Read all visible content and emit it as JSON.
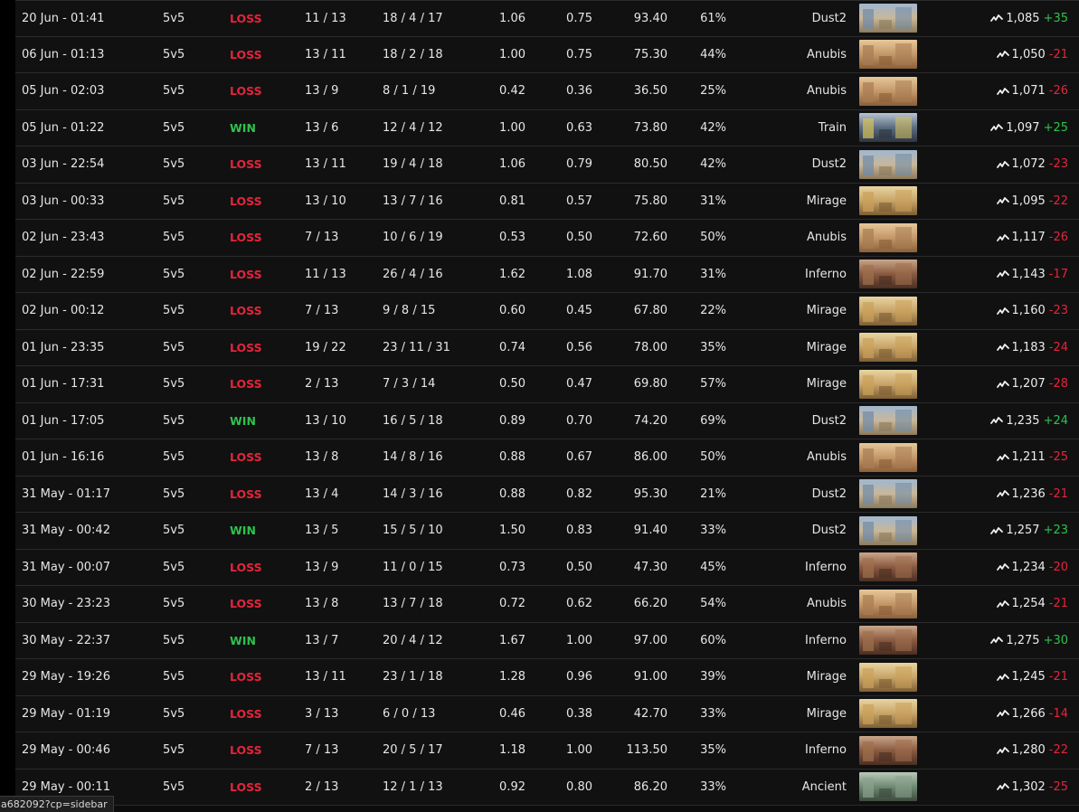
{
  "matches": [
    {
      "date": "20 Jun - 01:41",
      "mode": "5v5",
      "result": "LOSS",
      "score": "11 / 13",
      "kda": "18 / 4 / 17",
      "kd": "1.06",
      "kr": "0.75",
      "adr": "93.40",
      "hs": "61%",
      "map": "Dust2",
      "map_icon": "dust2-thumbnail",
      "elo": "1,085",
      "delta": "+35"
    },
    {
      "date": "06 Jun - 01:13",
      "mode": "5v5",
      "result": "LOSS",
      "score": "13 / 11",
      "kda": "18 / 2 / 18",
      "kd": "1.00",
      "kr": "0.75",
      "adr": "75.30",
      "hs": "44%",
      "map": "Anubis",
      "map_icon": "anubis-thumbnail",
      "elo": "1,050",
      "delta": "-21"
    },
    {
      "date": "05 Jun - 02:03",
      "mode": "5v5",
      "result": "LOSS",
      "score": "13 / 9",
      "kda": "8 / 1 / 19",
      "kd": "0.42",
      "kr": "0.36",
      "adr": "36.50",
      "hs": "25%",
      "map": "Anubis",
      "map_icon": "anubis-thumbnail",
      "elo": "1,071",
      "delta": "-26"
    },
    {
      "date": "05 Jun - 01:22",
      "mode": "5v5",
      "result": "WIN",
      "score": "13 / 6",
      "kda": "12 / 4 / 12",
      "kd": "1.00",
      "kr": "0.63",
      "adr": "73.80",
      "hs": "42%",
      "map": "Train",
      "map_icon": "train-thumbnail",
      "elo": "1,097",
      "delta": "+25"
    },
    {
      "date": "03 Jun - 22:54",
      "mode": "5v5",
      "result": "LOSS",
      "score": "13 / 11",
      "kda": "19 / 4 / 18",
      "kd": "1.06",
      "kr": "0.79",
      "adr": "80.50",
      "hs": "42%",
      "map": "Dust2",
      "map_icon": "dust2-thumbnail",
      "elo": "1,072",
      "delta": "-23"
    },
    {
      "date": "03 Jun - 00:33",
      "mode": "5v5",
      "result": "LOSS",
      "score": "13 / 10",
      "kda": "13 / 7 / 16",
      "kd": "0.81",
      "kr": "0.57",
      "adr": "75.80",
      "hs": "31%",
      "map": "Mirage",
      "map_icon": "mirage-thumbnail",
      "elo": "1,095",
      "delta": "-22"
    },
    {
      "date": "02 Jun - 23:43",
      "mode": "5v5",
      "result": "LOSS",
      "score": "7 / 13",
      "kda": "10 / 6 / 19",
      "kd": "0.53",
      "kr": "0.50",
      "adr": "72.60",
      "hs": "50%",
      "map": "Anubis",
      "map_icon": "anubis-thumbnail",
      "elo": "1,117",
      "delta": "-26"
    },
    {
      "date": "02 Jun - 22:59",
      "mode": "5v5",
      "result": "LOSS",
      "score": "11 / 13",
      "kda": "26 / 4 / 16",
      "kd": "1.62",
      "kr": "1.08",
      "adr": "91.70",
      "hs": "31%",
      "map": "Inferno",
      "map_icon": "inferno-thumbnail",
      "elo": "1,143",
      "delta": "-17"
    },
    {
      "date": "02 Jun - 00:12",
      "mode": "5v5",
      "result": "LOSS",
      "score": "7 / 13",
      "kda": "9 / 8 / 15",
      "kd": "0.60",
      "kr": "0.45",
      "adr": "67.80",
      "hs": "22%",
      "map": "Mirage",
      "map_icon": "mirage-thumbnail",
      "elo": "1,160",
      "delta": "-23"
    },
    {
      "date": "01 Jun - 23:35",
      "mode": "5v5",
      "result": "LOSS",
      "score": "19 / 22",
      "kda": "23 / 11 / 31",
      "kd": "0.74",
      "kr": "0.56",
      "adr": "78.00",
      "hs": "35%",
      "map": "Mirage",
      "map_icon": "mirage-thumbnail",
      "elo": "1,183",
      "delta": "-24"
    },
    {
      "date": "01 Jun - 17:31",
      "mode": "5v5",
      "result": "LOSS",
      "score": "2 / 13",
      "kda": "7 / 3 / 14",
      "kd": "0.50",
      "kr": "0.47",
      "adr": "69.80",
      "hs": "57%",
      "map": "Mirage",
      "map_icon": "mirage-thumbnail",
      "elo": "1,207",
      "delta": "-28"
    },
    {
      "date": "01 Jun - 17:05",
      "mode": "5v5",
      "result": "WIN",
      "score": "13 / 10",
      "kda": "16 / 5 / 18",
      "kd": "0.89",
      "kr": "0.70",
      "adr": "74.20",
      "hs": "69%",
      "map": "Dust2",
      "map_icon": "dust2-thumbnail",
      "elo": "1,235",
      "delta": "+24"
    },
    {
      "date": "01 Jun - 16:16",
      "mode": "5v5",
      "result": "LOSS",
      "score": "13 / 8",
      "kda": "14 / 8 / 16",
      "kd": "0.88",
      "kr": "0.67",
      "adr": "86.00",
      "hs": "50%",
      "map": "Anubis",
      "map_icon": "anubis-thumbnail",
      "elo": "1,211",
      "delta": "-25"
    },
    {
      "date": "31 May - 01:17",
      "mode": "5v5",
      "result": "LOSS",
      "score": "13 / 4",
      "kda": "14 / 3 / 16",
      "kd": "0.88",
      "kr": "0.82",
      "adr": "95.30",
      "hs": "21%",
      "map": "Dust2",
      "map_icon": "dust2-thumbnail",
      "elo": "1,236",
      "delta": "-21"
    },
    {
      "date": "31 May - 00:42",
      "mode": "5v5",
      "result": "WIN",
      "score": "13 / 5",
      "kda": "15 / 5 / 10",
      "kd": "1.50",
      "kr": "0.83",
      "adr": "91.40",
      "hs": "33%",
      "map": "Dust2",
      "map_icon": "dust2-thumbnail",
      "elo": "1,257",
      "delta": "+23"
    },
    {
      "date": "31 May - 00:07",
      "mode": "5v5",
      "result": "LOSS",
      "score": "13 / 9",
      "kda": "11 / 0 / 15",
      "kd": "0.73",
      "kr": "0.50",
      "adr": "47.30",
      "hs": "45%",
      "map": "Inferno",
      "map_icon": "inferno-thumbnail",
      "elo": "1,234",
      "delta": "-20"
    },
    {
      "date": "30 May - 23:23",
      "mode": "5v5",
      "result": "LOSS",
      "score": "13 / 8",
      "kda": "13 / 7 / 18",
      "kd": "0.72",
      "kr": "0.62",
      "adr": "66.20",
      "hs": "54%",
      "map": "Anubis",
      "map_icon": "anubis-thumbnail",
      "elo": "1,254",
      "delta": "-21"
    },
    {
      "date": "30 May - 22:37",
      "mode": "5v5",
      "result": "WIN",
      "score": "13 / 7",
      "kda": "20 / 4 / 12",
      "kd": "1.67",
      "kr": "1.00",
      "adr": "97.00",
      "hs": "60%",
      "map": "Inferno",
      "map_icon": "inferno-thumbnail",
      "elo": "1,275",
      "delta": "+30"
    },
    {
      "date": "29 May - 19:26",
      "mode": "5v5",
      "result": "LOSS",
      "score": "13 / 11",
      "kda": "23 / 1 / 18",
      "kd": "1.28",
      "kr": "0.96",
      "adr": "91.00",
      "hs": "39%",
      "map": "Mirage",
      "map_icon": "mirage-thumbnail",
      "elo": "1,245",
      "delta": "-21"
    },
    {
      "date": "29 May - 01:19",
      "mode": "5v5",
      "result": "LOSS",
      "score": "3 / 13",
      "kda": "6 / 0 / 13",
      "kd": "0.46",
      "kr": "0.38",
      "adr": "42.70",
      "hs": "33%",
      "map": "Mirage",
      "map_icon": "mirage-thumbnail",
      "elo": "1,266",
      "delta": "-14"
    },
    {
      "date": "29 May - 00:46",
      "mode": "5v5",
      "result": "LOSS",
      "score": "7 / 13",
      "kda": "20 / 5 / 17",
      "kd": "1.18",
      "kr": "1.00",
      "adr": "113.50",
      "hs": "35%",
      "map": "Inferno",
      "map_icon": "inferno-thumbnail",
      "elo": "1,280",
      "delta": "-22"
    },
    {
      "date": "29 May - 00:11",
      "mode": "5v5",
      "result": "LOSS",
      "score": "2 / 13",
      "kda": "12 / 1 / 13",
      "kd": "0.92",
      "kr": "0.80",
      "adr": "86.20",
      "hs": "33%",
      "map": "Ancient",
      "map_icon": "ancient-thumbnail",
      "elo": "1,302",
      "delta": "-25"
    }
  ],
  "colors": {
    "loss": "#e5243b",
    "win": "#2fc14e",
    "row_bg": "#111111",
    "row_border": "#2b2b2b"
  },
  "elo_icon": "elo-trend-icon",
  "status_bar": {
    "url": "a682092?cp=sidebar"
  }
}
